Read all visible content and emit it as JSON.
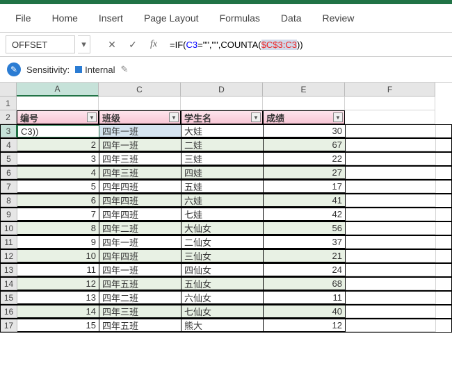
{
  "ribbon": {
    "tabs": [
      "File",
      "Home",
      "Insert",
      "Page Layout",
      "Formulas",
      "Data",
      "Review"
    ]
  },
  "name_box": "OFFSET",
  "formula": {
    "prefix": "=IF(",
    "ref1": "C3",
    "mid1": "=\"\",\"\",COUNTA(",
    "ref2": "$C$3:C3",
    "suffix": "))"
  },
  "sensitivity": {
    "label": "Sensitivity:",
    "value": "Internal"
  },
  "columns": [
    "A",
    "C",
    "D",
    "E",
    "F"
  ],
  "headers": {
    "A": "编号",
    "C": "班级",
    "D": "学生名",
    "E": "成绩"
  },
  "editing_text": "C3))",
  "rows": [
    {
      "n": 3,
      "A": "",
      "C": "四年一班",
      "D": "大娃",
      "E": "30"
    },
    {
      "n": 4,
      "A": "2",
      "C": "四年一班",
      "D": "二娃",
      "E": "67"
    },
    {
      "n": 5,
      "A": "3",
      "C": "四年三班",
      "D": "三娃",
      "E": "22"
    },
    {
      "n": 6,
      "A": "4",
      "C": "四年三班",
      "D": "四娃",
      "E": "27"
    },
    {
      "n": 7,
      "A": "5",
      "C": "四年四班",
      "D": "五娃",
      "E": "17"
    },
    {
      "n": 8,
      "A": "6",
      "C": "四年四班",
      "D": "六娃",
      "E": "41"
    },
    {
      "n": 9,
      "A": "7",
      "C": "四年四班",
      "D": "七娃",
      "E": "42"
    },
    {
      "n": 10,
      "A": "8",
      "C": "四年二班",
      "D": "大仙女",
      "E": "56"
    },
    {
      "n": 11,
      "A": "9",
      "C": "四年一班",
      "D": "二仙女",
      "E": "37"
    },
    {
      "n": 12,
      "A": "10",
      "C": "四年四班",
      "D": "三仙女",
      "E": "21"
    },
    {
      "n": 13,
      "A": "11",
      "C": "四年一班",
      "D": "四仙女",
      "E": "24"
    },
    {
      "n": 14,
      "A": "12",
      "C": "四年五班",
      "D": "五仙女",
      "E": "68"
    },
    {
      "n": 15,
      "A": "13",
      "C": "四年二班",
      "D": "六仙女",
      "E": "11"
    },
    {
      "n": 16,
      "A": "14",
      "C": "四年三班",
      "D": "七仙女",
      "E": "40"
    },
    {
      "n": 17,
      "A": "15",
      "C": "四年五班",
      "D": "熊大",
      "E": "12"
    }
  ]
}
